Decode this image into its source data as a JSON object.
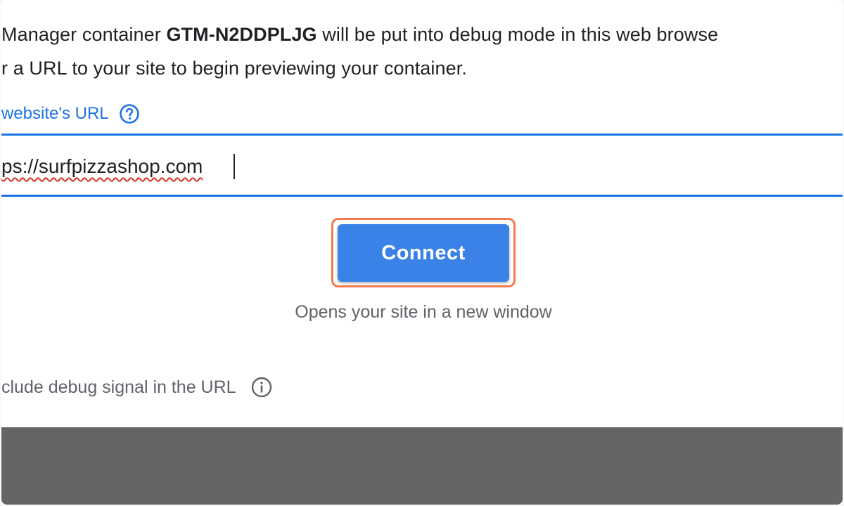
{
  "intro": {
    "line1_prefix": "Manager container ",
    "container_id": "GTM-N2DDPLJG",
    "line1_suffix": " will be put into debug mode in this web browse",
    "line2": "r a URL to your site to begin previewing your container."
  },
  "url_field": {
    "label": "website's URL",
    "help_icon": "help-circle-icon",
    "value": "ps://surfpizzashop.com"
  },
  "connect": {
    "label": "Connect",
    "hint": "Opens your site in a new window"
  },
  "debug_option": {
    "label": "clude debug signal in the URL",
    "info_icon": "info-icon"
  },
  "colors": {
    "accent": "#1a73e8",
    "button": "#3b82e8",
    "highlight": "#ef7c4d",
    "backdrop": "#656565"
  }
}
